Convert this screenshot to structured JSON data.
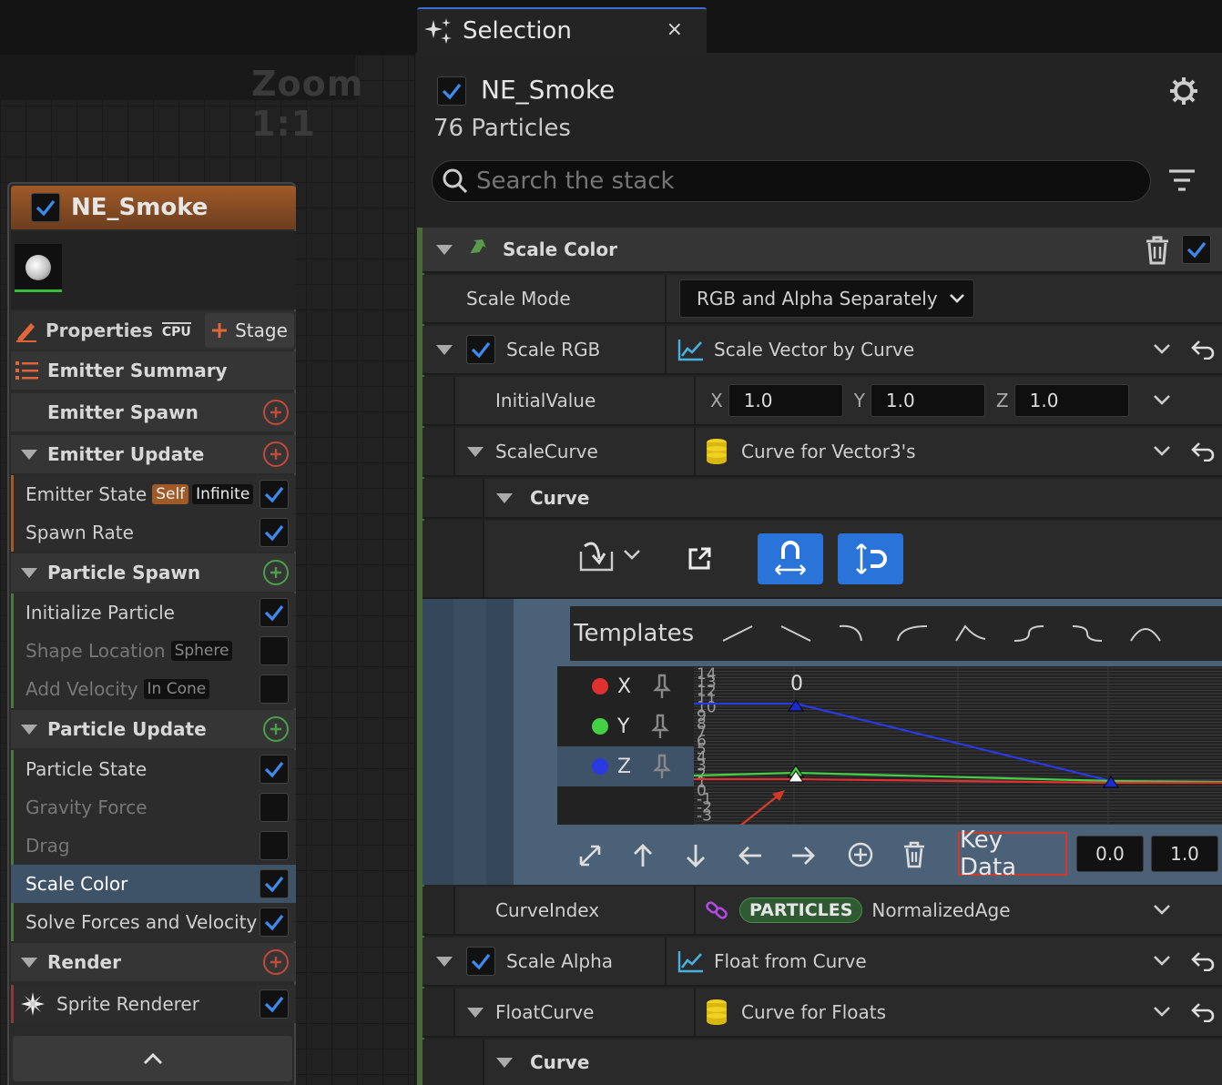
{
  "graph": {
    "zoom_label": "Zoom 1:1"
  },
  "node": {
    "title": "NE_Smoke",
    "properties_label": "Properties",
    "cpu_label": "CPU",
    "stage_label": "Stage",
    "summary_label": "Emitter Summary",
    "sections": [
      {
        "label": "Emitter Spawn"
      },
      {
        "label": "Emitter Update"
      },
      {
        "label": "Particle Spawn"
      },
      {
        "label": "Particle Update"
      },
      {
        "label": "Render"
      }
    ],
    "emitter_state": {
      "label": "Emitter State",
      "tag1": "Self",
      "tag2": "Infinite"
    },
    "spawn_rate": "Spawn Rate",
    "initialize_particle": "Initialize Particle",
    "shape_location": {
      "label": "Shape Location",
      "tag": "Sphere"
    },
    "add_velocity": {
      "label": "Add Velocity",
      "tag": "In Cone"
    },
    "particle_state": "Particle State",
    "gravity_force": "Gravity Force",
    "drag": "Drag",
    "scale_color": "Scale Color",
    "solve_forces": "Solve Forces and Velocity",
    "sprite_renderer": "Sprite Renderer"
  },
  "panel": {
    "tab_title": "Selection",
    "tab_close": "×",
    "emitter_title": "NE_Smoke",
    "particle_count": "76 Particles",
    "search_placeholder": "Search the stack",
    "module_title": "Scale Color",
    "scale_mode_label": "Scale Mode",
    "scale_mode_value": "RGB and Alpha Separately",
    "scale_rgb_label": "Scale RGB",
    "scale_rgb_value": "Scale Vector by Curve",
    "initial_value_label": "InitialValue",
    "x_label": "X",
    "x_value": "1.0",
    "y_label": "Y",
    "y_value": "1.0",
    "z_label": "Z",
    "z_value": "1.0",
    "scale_curve_label": "ScaleCurve",
    "scale_curve_value": "Curve for Vector3's",
    "curve_label": "Curve",
    "templates_label": "Templates",
    "channels": [
      "X",
      "Y",
      "Z"
    ],
    "graph_top_label": "0",
    "graph_ticks": [
      "14",
      "13",
      "12",
      "11",
      "10",
      "9",
      "8",
      "7",
      "6",
      "5",
      "4",
      "3",
      "2",
      "1",
      "0",
      "-1",
      "-2",
      "-3"
    ],
    "key_data_label": "Key Data",
    "key_time": "0.0",
    "key_value": "1.0",
    "curve_index_label": "CurveIndex",
    "curve_index_pill": "PARTICLES",
    "curve_index_value": "NormalizedAge",
    "scale_alpha_label": "Scale Alpha",
    "scale_alpha_value": "Float from Curve",
    "float_curve_label": "FloatCurve",
    "float_curve_value": "Curve for Floats",
    "curve2_label": "Curve"
  },
  "colors": {
    "accent": "#2a73d8",
    "node_header": "#a05a28",
    "selected_row": "#3e5268",
    "x_channel": "#e03030",
    "y_channel": "#44d044",
    "z_channel": "#2a3ae0",
    "key_data_outline": "#d03a2a"
  }
}
